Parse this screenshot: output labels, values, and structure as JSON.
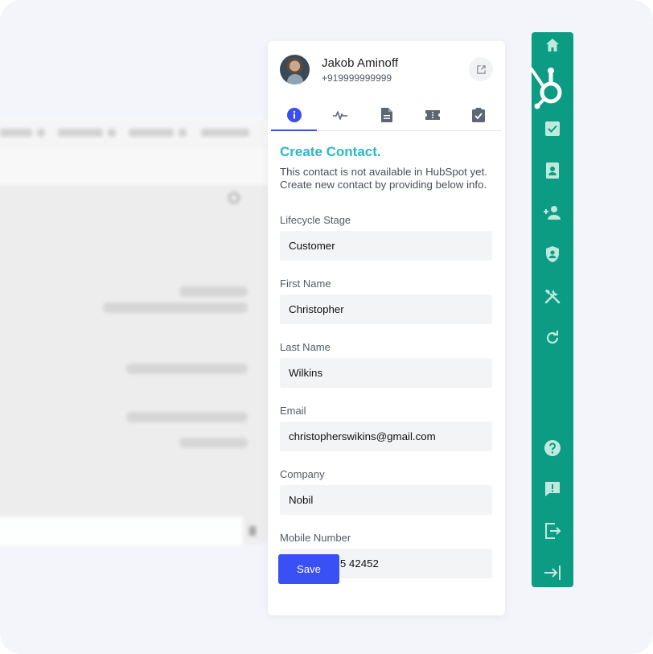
{
  "contact": {
    "name": "Jakob Aminoff",
    "phone": "+919999999999"
  },
  "tabs": [
    {
      "name": "info",
      "icon": "info-icon",
      "active": true
    },
    {
      "name": "activity",
      "icon": "activity-icon",
      "active": false
    },
    {
      "name": "notes",
      "icon": "document-icon",
      "active": false
    },
    {
      "name": "tickets",
      "icon": "ticket-icon",
      "active": false
    },
    {
      "name": "tasks",
      "icon": "clipboard-check-icon",
      "active": false
    }
  ],
  "form": {
    "title": "Create Contact.",
    "description": "This contact is not available in HubSpot yet. Create new contact by providing below info.",
    "fields": {
      "lifecycle_label": "Lifecycle Stage",
      "lifecycle_value": "Customer",
      "first_name_label": "First Name",
      "first_name_value": "Christopher",
      "last_name_label": "Last Name",
      "last_name_value": "Wilkins",
      "email_label": "Email",
      "email_value": "christopherswikins@gmail.com",
      "company_label": "Company",
      "company_value": "Nobil",
      "mobile_label": "Mobile Number",
      "mobile_prefix": "+",
      "mobile_value": "91 98765 42452"
    },
    "save_label": "Save"
  },
  "colors": {
    "accent": "#3950f5",
    "title": "#2bb8c8",
    "sidebar": "#0c9c83",
    "canvas": "#f4f5fb"
  }
}
